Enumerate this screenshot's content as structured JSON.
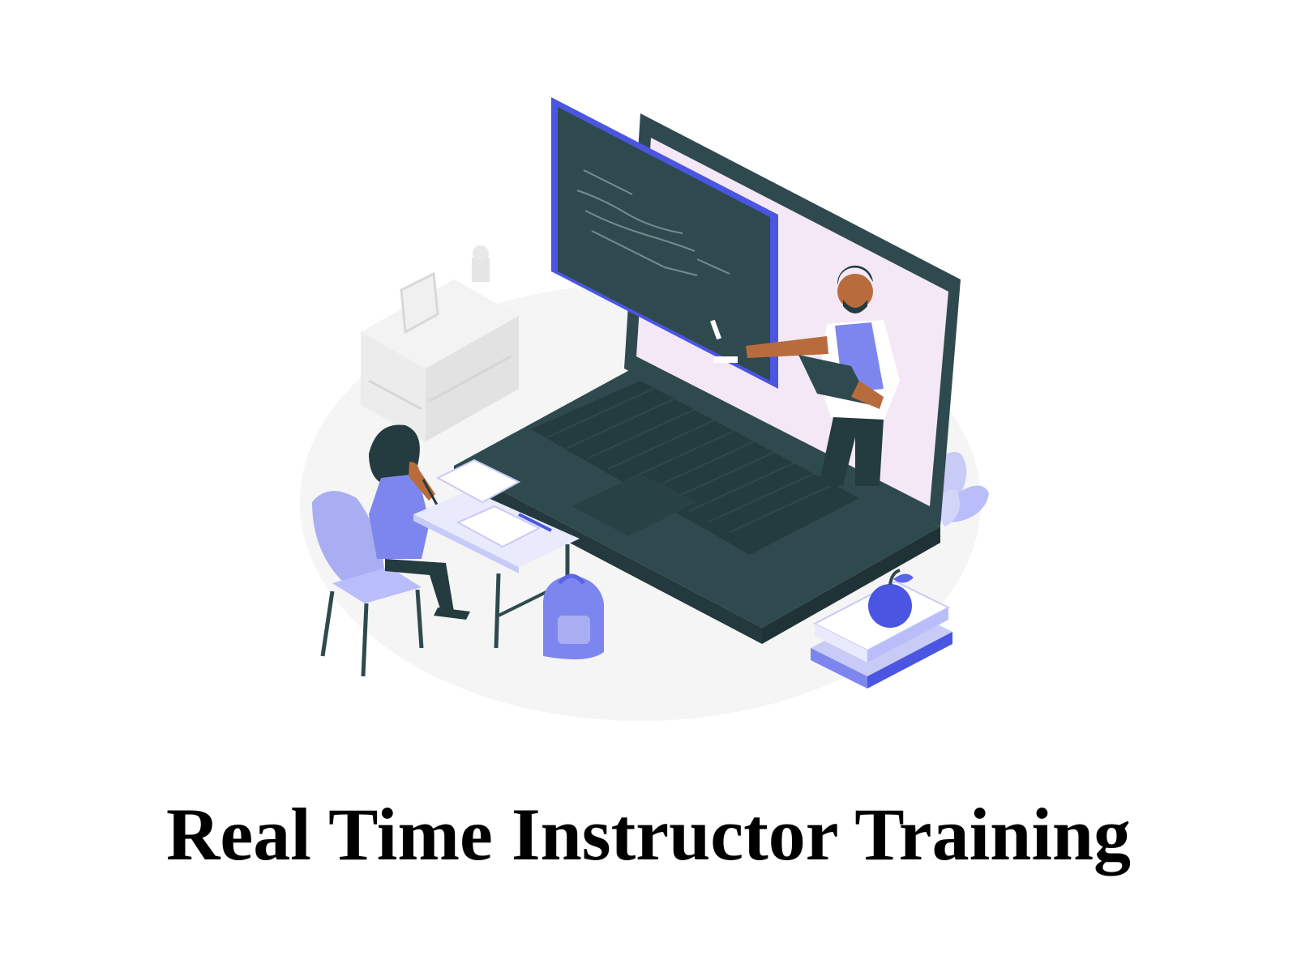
{
  "caption": {
    "title": "Real Time Instructor Training"
  },
  "illustration": {
    "icon": "online-instructor-training-illustration",
    "colors": {
      "accent": "#4a56e2",
      "accent_light": "#a9aef2",
      "dark": "#2f4a4f",
      "skin": "#b86b3c",
      "screen_bg": "#f5e8f6",
      "floor": "#f4f4f4",
      "furniture": "#ececec"
    }
  }
}
